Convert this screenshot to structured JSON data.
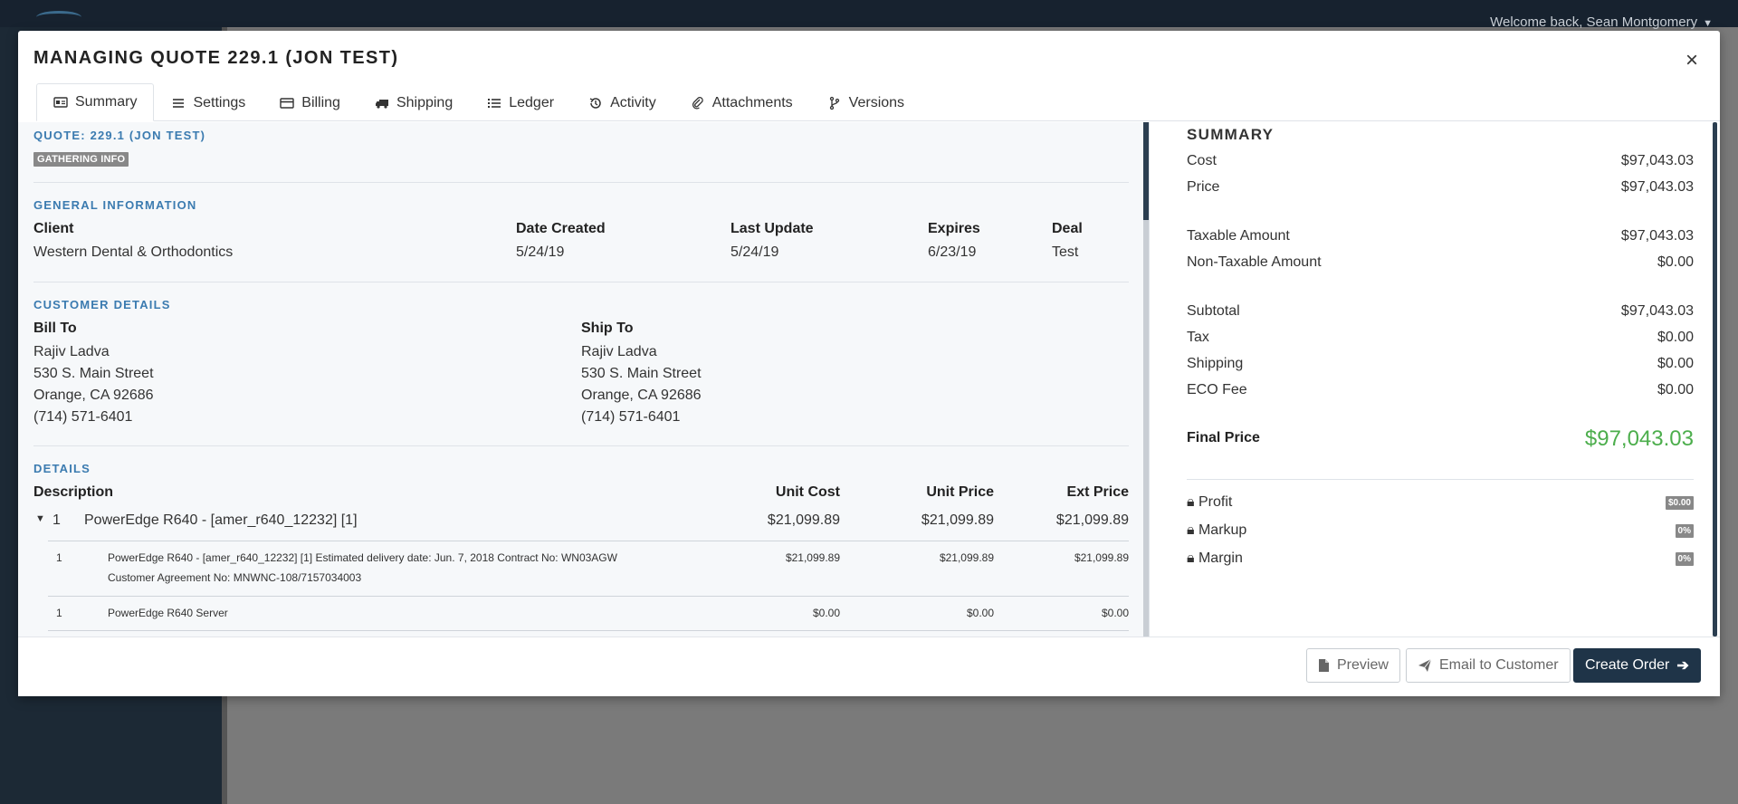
{
  "background": {
    "welcome": "Welcome back, Sean Montgomery"
  },
  "modal": {
    "title": "MANAGING QUOTE 229.1 (JON TEST)",
    "tabs": [
      {
        "label": "Summary",
        "icon": "id-card-icon"
      },
      {
        "label": "Settings",
        "icon": "bars-icon"
      },
      {
        "label": "Billing",
        "icon": "credit-card-icon"
      },
      {
        "label": "Shipping",
        "icon": "truck-icon"
      },
      {
        "label": "Ledger",
        "icon": "list-icon"
      },
      {
        "label": "Activity",
        "icon": "history-icon"
      },
      {
        "label": "Attachments",
        "icon": "paperclip-icon"
      },
      {
        "label": "Versions",
        "icon": "code-branch-icon"
      }
    ]
  },
  "quote": {
    "heading": "QUOTE: 229.1 (JON TEST)",
    "status": "GATHERING INFO"
  },
  "general": {
    "title": "GENERAL INFORMATION",
    "client_label": "Client",
    "client": "Western Dental & Orthodontics",
    "created_label": "Date Created",
    "created": "5/24/19",
    "updated_label": "Last Update",
    "updated": "5/24/19",
    "expires_label": "Expires",
    "expires": "6/23/19",
    "deal_label": "Deal",
    "deal": "Test"
  },
  "customer": {
    "title": "CUSTOMER DETAILS",
    "bill_to": {
      "label": "Bill To",
      "name": "Rajiv Ladva",
      "street": "530 S. Main Street",
      "city": "Orange, CA 92686",
      "phone": "(714) 571-6401"
    },
    "ship_to": {
      "label": "Ship To",
      "name": "Rajiv Ladva",
      "street": "530 S. Main Street",
      "city": "Orange, CA 92686",
      "phone": "(714) 571-6401"
    }
  },
  "details": {
    "title": "DETAILS",
    "headers": {
      "description": "Description",
      "unit_cost": "Unit Cost",
      "unit_price": "Unit Price",
      "ext_price": "Ext Price"
    },
    "group": {
      "qty": "1",
      "description": "PowerEdge R640 - [amer_r640_12232] [1]",
      "unit_cost": "$21,099.89",
      "unit_price": "$21,099.89",
      "ext_price": "$21,099.89"
    },
    "items": [
      {
        "qty": "1",
        "line1": "PowerEdge R640 - [amer_r640_12232] [1] Estimated delivery date: Jun. 7, 2018 Contract No: WN03AGW",
        "line2": "Customer Agreement No: MNWNC-108/7157034003",
        "unit_cost": "$21,099.89",
        "unit_price": "$21,099.89",
        "ext_price": "$21,099.89"
      },
      {
        "qty": "1",
        "line1": "PowerEdge R640 Server",
        "line2": "",
        "unit_cost": "$0.00",
        "unit_price": "$0.00",
        "ext_price": "$0.00"
      }
    ]
  },
  "summary": {
    "title": "SUMMARY",
    "cost_label": "Cost",
    "cost": "$97,043.03",
    "price_label": "Price",
    "price": "$97,043.03",
    "taxable_label": "Taxable Amount",
    "taxable": "$97,043.03",
    "nontaxable_label": "Non-Taxable Amount",
    "nontaxable": "$0.00",
    "subtotal_label": "Subtotal",
    "subtotal": "$97,043.03",
    "tax_label": "Tax",
    "tax": "$0.00",
    "shipping_label": "Shipping",
    "shipping": "$0.00",
    "eco_label": "ECO Fee",
    "eco": "$0.00",
    "final_label": "Final Price",
    "final": "$97,043.03",
    "final_color": "#4cae4c",
    "profit_label": "Profit",
    "profit": "$0.00",
    "markup_label": "Markup",
    "markup": "0%",
    "margin_label": "Margin",
    "margin": "0%"
  },
  "footer": {
    "preview": "Preview",
    "email": "Email to Customer",
    "create_order": "Create Order"
  }
}
